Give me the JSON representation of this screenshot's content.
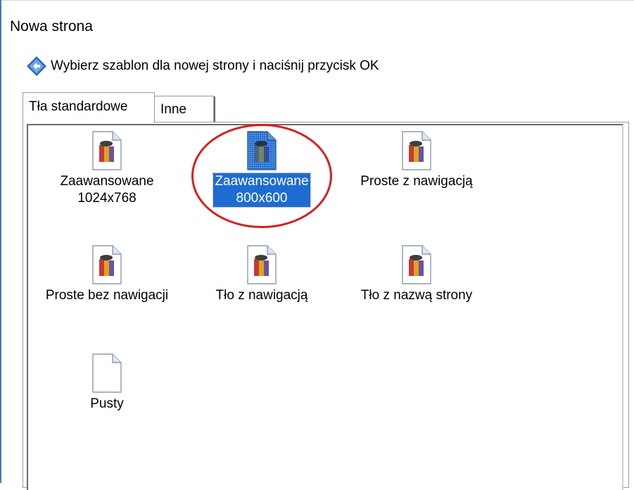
{
  "window": {
    "title": "Nowa strona"
  },
  "hint": {
    "text": "Wybierz szablon dla nowej strony i naciśnij przycisk OK",
    "icon": "info-diamond-icon"
  },
  "tabs": [
    {
      "label": "Tła standardowe",
      "active": true
    },
    {
      "label": "Inne",
      "active": false
    }
  ],
  "templates": [
    {
      "label": "Zaawansowane\n1024x768",
      "icon": "template-doc-icon",
      "selected": false
    },
    {
      "label": "Zaawansowane\n800x600",
      "icon": "template-doc-icon",
      "selected": true
    },
    {
      "label": "Proste z nawigacją",
      "icon": "template-doc-icon",
      "selected": false
    },
    {
      "label": "Proste bez nawigacji",
      "icon": "template-doc-icon",
      "selected": false
    },
    {
      "label": "Tło z nawigacją",
      "icon": "template-doc-icon",
      "selected": false
    },
    {
      "label": "Tło z nazwą strony",
      "icon": "template-doc-icon",
      "selected": false
    },
    {
      "label": "Pusty",
      "icon": "blank-doc-icon",
      "selected": false
    }
  ],
  "colors": {
    "selection": "#1e6cd2",
    "annotation_circle": "#d62020"
  }
}
